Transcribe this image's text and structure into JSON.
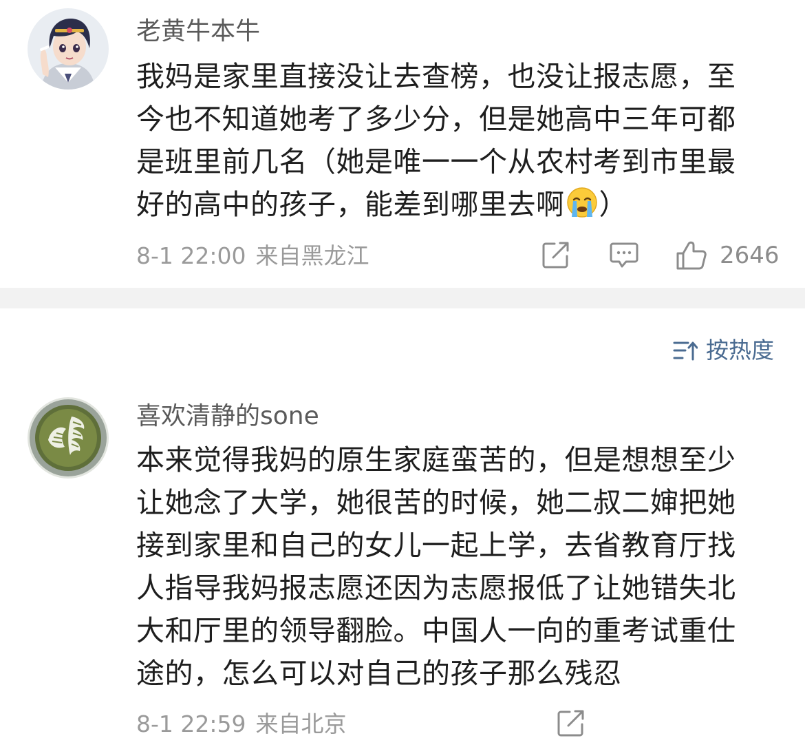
{
  "comments": [
    {
      "username": "老黄牛本牛",
      "lines": [
        "我妈是家里直接没让去查榜，也没让报志愿，至",
        "今也不知道她考了多少分，但是她高中三年可都",
        "是班里前几名（她是唯一一个从农村考到市里最"
      ],
      "last_line_before_emoji": "好的高中的孩子，能差到哪里去啊",
      "emoji": "crying-face-emoji",
      "last_line_after_emoji": "）",
      "timestamp": "8-1 22:00",
      "location": "来自黑龙江",
      "like_count": "2646"
    },
    {
      "username": "喜欢清静的sone",
      "lines": [
        "本来觉得我妈的原生家庭蛮苦的，但是想想至少",
        "让她念了大学，她很苦的时候，她二叔二婶把她",
        "接到家里和自己的女儿一起上学，去省教育厅找",
        "人指导我妈报志愿还因为志愿报低了让她错失北",
        "大和厅里的领导翻脸。中国人一向的重考试重仕",
        "途的，怎么可以对自己的孩子那么残忍"
      ],
      "timestamp": "8-1 22:59",
      "location": "来自北京"
    }
  ],
  "sort": {
    "label": "按热度",
    "icon": "sort-icon"
  },
  "icons": {
    "share": "share-icon",
    "reply": "comment-icon",
    "like": "thumbs-up-icon"
  },
  "colors": {
    "username": "#5a5a5a",
    "meta": "#9a9a9a",
    "sort_accent": "#4a6b91",
    "divider": "#f2f2f2"
  }
}
